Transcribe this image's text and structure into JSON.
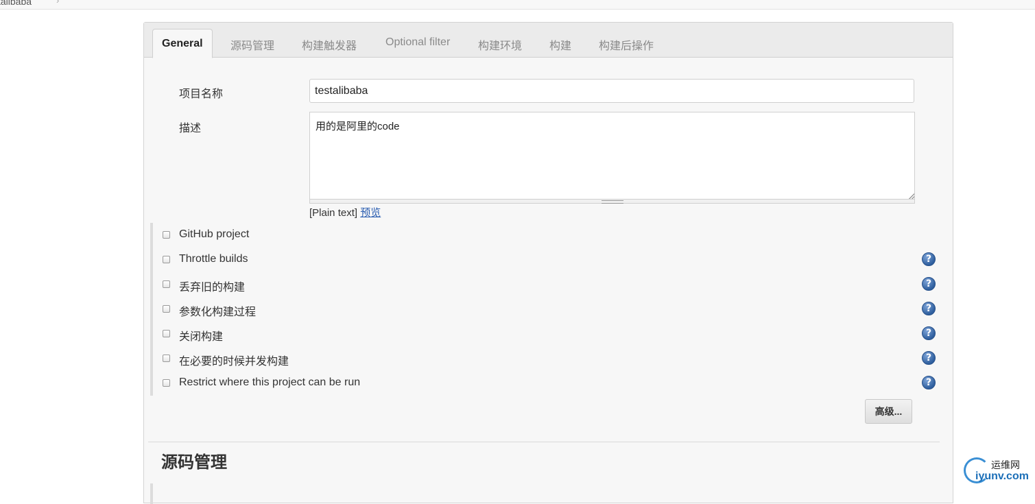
{
  "breadcrumb": {
    "text": "talibaba",
    "arrow": "›"
  },
  "tabs": [
    {
      "label": "General",
      "active": true
    },
    {
      "label": "源码管理"
    },
    {
      "label": "构建触发器"
    },
    {
      "label": "Optional filter"
    },
    {
      "label": "构建环境"
    },
    {
      "label": "构建"
    },
    {
      "label": "构建后操作"
    }
  ],
  "general": {
    "project_name_label": "项目名称",
    "project_name_value": "testalibaba",
    "description_label": "描述",
    "description_value": "用的是阿里的code",
    "plain_text_hint": "[Plain text]",
    "preview_link": "预览"
  },
  "options": [
    {
      "label": "GitHub project",
      "checked": false,
      "help": false
    },
    {
      "label": "Throttle builds",
      "checked": false,
      "help": true
    },
    {
      "label": "丢弃旧的构建",
      "checked": false,
      "help": true
    },
    {
      "label": "参数化构建过程",
      "checked": false,
      "help": true
    },
    {
      "label": "关闭构建",
      "checked": false,
      "help": true
    },
    {
      "label": "在必要的时候并发构建",
      "checked": false,
      "help": true
    },
    {
      "label": "Restrict where this project can be run",
      "checked": false,
      "help": true
    }
  ],
  "help_glyph": "?",
  "advanced_button": "高级...",
  "next_section_title": "源码管理",
  "watermark": {
    "cn": "运维网",
    "en": "iyunv.com"
  },
  "colors": {
    "help_icon": "#2f5f9e",
    "link": "#2a5db0",
    "panel_bg": "#f7f7f7"
  }
}
